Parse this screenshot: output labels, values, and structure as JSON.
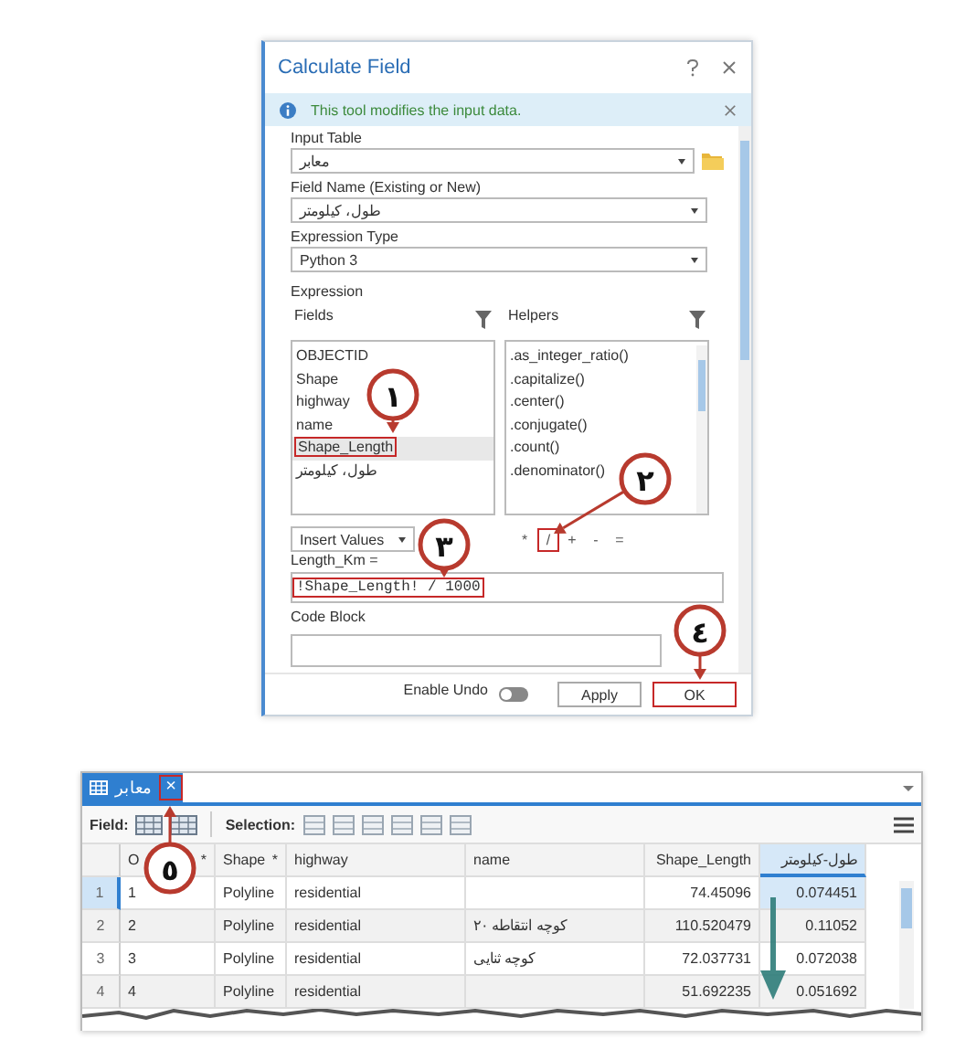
{
  "dialog": {
    "title": "Calculate Field",
    "info": "This tool modifies the input data.",
    "input_table": {
      "label": "Input Table",
      "value": "معابر"
    },
    "field_name": {
      "label": "Field Name (Existing or New)",
      "value": "طول، کیلومتر"
    },
    "expression_type": {
      "label": "Expression Type",
      "value": "Python 3"
    },
    "expression_label": "Expression",
    "fields_header": "Fields",
    "helpers_header": "Helpers",
    "field_list": [
      {
        "label": "OBJECTID",
        "selected": false,
        "highlighted": false
      },
      {
        "label": "Shape",
        "selected": false,
        "highlighted": false
      },
      {
        "label": "highway",
        "selected": false,
        "highlighted": false
      },
      {
        "label": "name",
        "selected": false,
        "highlighted": false
      },
      {
        "label": "Shape_Length",
        "selected": true,
        "highlighted": true
      },
      {
        "label": "طول، کیلومتر",
        "selected": false,
        "highlighted": false
      }
    ],
    "helper_list": [
      ".as_integer_ratio()",
      ".capitalize()",
      ".center()",
      ".conjugate()",
      ".count()",
      ".denominator()"
    ],
    "insert_values": "Insert Values",
    "operators": [
      {
        "label": "*",
        "highlighted": false
      },
      {
        "label": "/",
        "highlighted": true
      },
      {
        "label": "+",
        "highlighted": false
      },
      {
        "label": "-",
        "highlighted": false
      },
      {
        "label": "=",
        "highlighted": false
      }
    ],
    "expression_target": "Length_Km =",
    "expression": {
      "value": "!Shape_Length! / 1000",
      "highlighted": true
    },
    "code_block_label": "Code Block",
    "enable_undo": {
      "label": "Enable Undo",
      "on": false
    },
    "buttons": [
      {
        "label": "Apply",
        "highlighted": false
      },
      {
        "label": "OK",
        "highlighted": true
      }
    ]
  },
  "table": {
    "tab": {
      "title": "معابر",
      "close": "×",
      "close_highlighted": true
    },
    "field_label": "Field:",
    "selection_label": "Selection:",
    "columns": [
      {
        "label": "O",
        "required_mark": "*",
        "selected": false
      },
      {
        "label": "Shape",
        "required_mark": "*",
        "selected": false
      },
      {
        "label": "highway",
        "selected": false
      },
      {
        "label": "name",
        "selected": false
      },
      {
        "label": "Shape_Length",
        "selected": false
      },
      {
        "label": "طول-کیلومتر",
        "selected": true
      }
    ],
    "rows": [
      {
        "number": "1",
        "selected": true,
        "cells": [
          "1",
          "Polyline",
          "residential",
          "",
          "74.45096",
          "0.074451"
        ]
      },
      {
        "number": "2",
        "selected": false,
        "cells": [
          "2",
          "Polyline",
          "residential",
          "کوچه انتقاطه ۲۰",
          "110.520479",
          "0.11052"
        ]
      },
      {
        "number": "3",
        "selected": false,
        "cells": [
          "3",
          "Polyline",
          "residential",
          "کوچه ثنایی",
          "72.037731",
          "0.072038"
        ]
      },
      {
        "number": "4",
        "selected": false,
        "cells": [
          "4",
          "Polyline",
          "residential",
          "",
          "51.692235",
          "0.051692"
        ]
      }
    ]
  },
  "callouts": [
    {
      "number": "١"
    },
    {
      "number": "٢"
    },
    {
      "number": "٣"
    },
    {
      "number": "٤"
    },
    {
      "number": "٥"
    }
  ]
}
